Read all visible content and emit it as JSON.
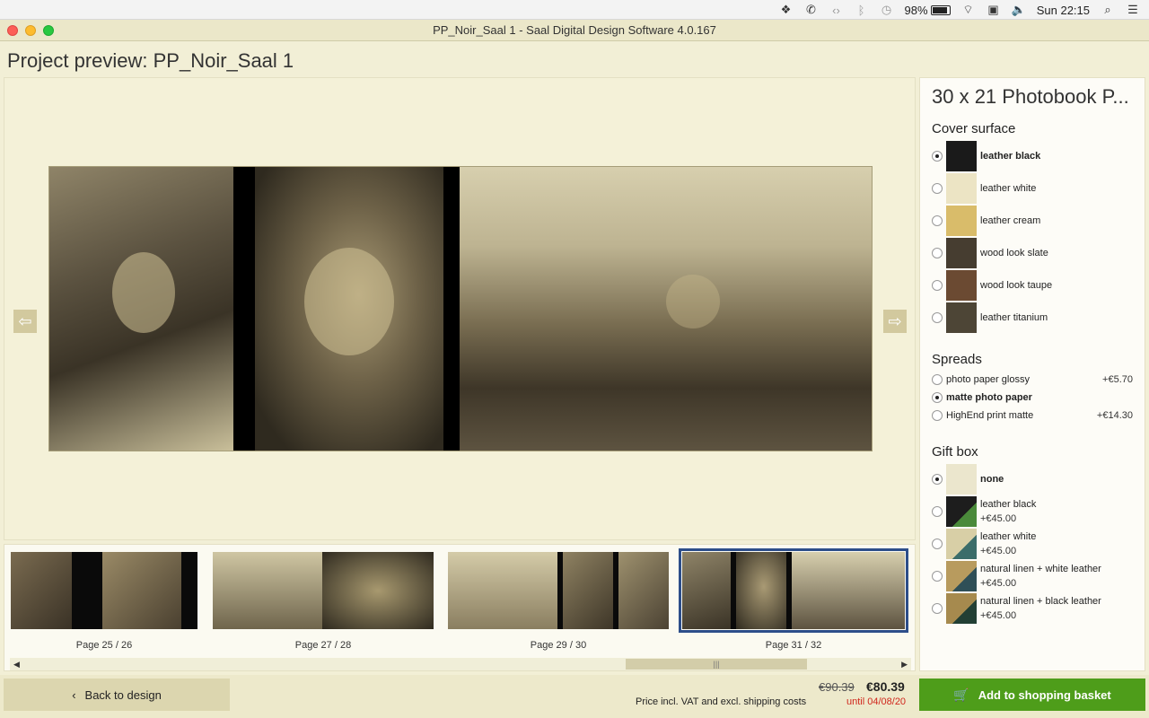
{
  "menubar": {
    "battery": "98%",
    "clock": "Sun 22:15"
  },
  "window": {
    "title": "PP_Noir_Saal 1 - Saal Digital Design Software 4.0.167"
  },
  "page_title": "Project preview: PP_Noir_Saal 1",
  "thumbnails": [
    {
      "label": "Page 25 / 26"
    },
    {
      "label": "Page 27 / 28"
    },
    {
      "label": "Page 29 / 30"
    },
    {
      "label": "Page 31 / 32"
    }
  ],
  "panel": {
    "product_title": "30 x 21 Photobook P...",
    "cover": {
      "title": "Cover surface",
      "options": [
        {
          "label": "leather black",
          "color": "#1a1a1a"
        },
        {
          "label": "leather white",
          "color": "#ece4c4"
        },
        {
          "label": "leather cream",
          "color": "#d9bc6a"
        },
        {
          "label": "wood look slate",
          "color": "#463d30"
        },
        {
          "label": "wood look taupe",
          "color": "#6b4a32"
        },
        {
          "label": "leather titanium",
          "color": "#4d4536"
        }
      ]
    },
    "spreads": {
      "title": "Spreads",
      "options": [
        {
          "label": "photo paper glossy",
          "price": "+€5.70"
        },
        {
          "label": "matte photo paper",
          "price": ""
        },
        {
          "label": "HighEnd print matte",
          "price": "+€14.30"
        }
      ]
    },
    "giftbox": {
      "title": "Gift box",
      "options": [
        {
          "label": "none",
          "price": "",
          "color": "#ebe6cd"
        },
        {
          "label": "leather black",
          "price": "+€45.00",
          "color": "#1d1d1d"
        },
        {
          "label": "leather white",
          "price": "+€45.00",
          "color": "#d8cfa6"
        },
        {
          "label": "natural linen + white leather",
          "price": "+€45.00",
          "color": "#b89b5e"
        },
        {
          "label": "natural linen + black leather",
          "price": "+€45.00",
          "color": "#a68a4e"
        }
      ]
    }
  },
  "bottom": {
    "back_label": "Back to design",
    "price_old": "€90.39",
    "price_new": "€80.39",
    "price_note": "Price incl. VAT and excl. shipping costs",
    "price_until": "until 04/08/20",
    "basket_label": "Add to shopping basket"
  },
  "colors": {
    "accent_green": "#4e9d1a",
    "selection_blue": "#2d4e8a",
    "sale_red": "#d0261c"
  }
}
